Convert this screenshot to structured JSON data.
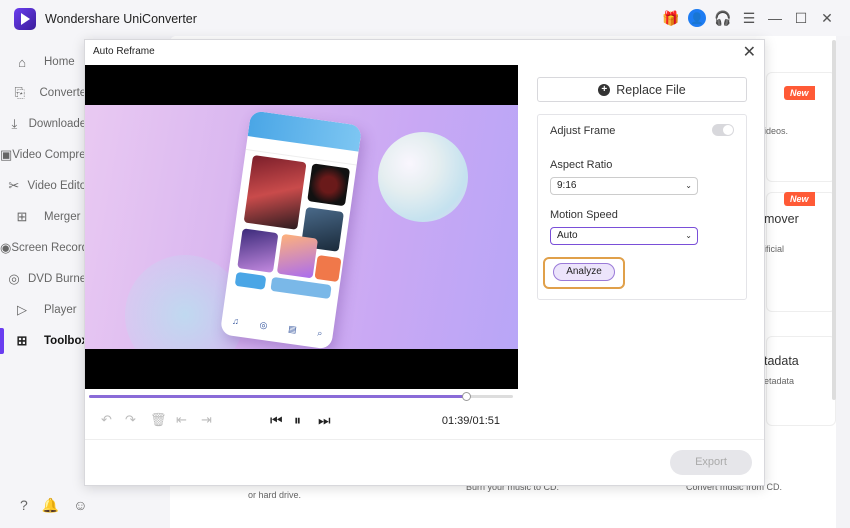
{
  "app": {
    "title": "Wondershare UniConverter"
  },
  "titlebar": {
    "icons": [
      "gift-icon",
      "user-icon",
      "headset-icon",
      "menu-icon",
      "minimize-icon",
      "maximize-icon",
      "close-icon"
    ]
  },
  "sidebar": {
    "items": [
      {
        "label": "Home",
        "icon": "home-icon"
      },
      {
        "label": "Converter",
        "icon": "converter-icon"
      },
      {
        "label": "Downloader",
        "icon": "download-icon"
      },
      {
        "label": "Video Compressor",
        "icon": "compress-icon"
      },
      {
        "label": "Video Editor",
        "icon": "scissors-icon"
      },
      {
        "label": "Merger",
        "icon": "merge-icon"
      },
      {
        "label": "Screen Recorder",
        "icon": "record-icon"
      },
      {
        "label": "DVD Burner",
        "icon": "disc-icon"
      },
      {
        "label": "Player",
        "icon": "play-icon"
      },
      {
        "label": "Toolbox",
        "icon": "grid-icon"
      }
    ],
    "bottom_icons": [
      "help-icon",
      "bell-icon",
      "feedback-icon"
    ]
  },
  "background": {
    "card1": {
      "badge": "New",
      "text": "ideos."
    },
    "card2": {
      "badge": "New",
      "title": "mover",
      "text": "ificial"
    },
    "card3": {
      "title": "tadata",
      "text": "etadata"
    },
    "bottom": [
      "hard drive.",
      "or hard drive.",
      "Burn your music to CD.",
      "Convert music from CD."
    ]
  },
  "modal": {
    "title": "Auto Reframe",
    "time": "01:39/01:51",
    "progress": 0.89,
    "replace_label": "Replace File",
    "adjust_frame_label": "Adjust Frame",
    "adjust_frame_on": false,
    "aspect_ratio_label": "Aspect Ratio",
    "aspect_ratio_value": "9:16",
    "motion_speed_label": "Motion Speed",
    "motion_speed_value": "Auto",
    "analyze_label": "Analyze",
    "export_label": "Export"
  },
  "colors": {
    "accent": "#6a3df0",
    "badge": "#ff5a36",
    "highlight": "#e0a04a"
  }
}
